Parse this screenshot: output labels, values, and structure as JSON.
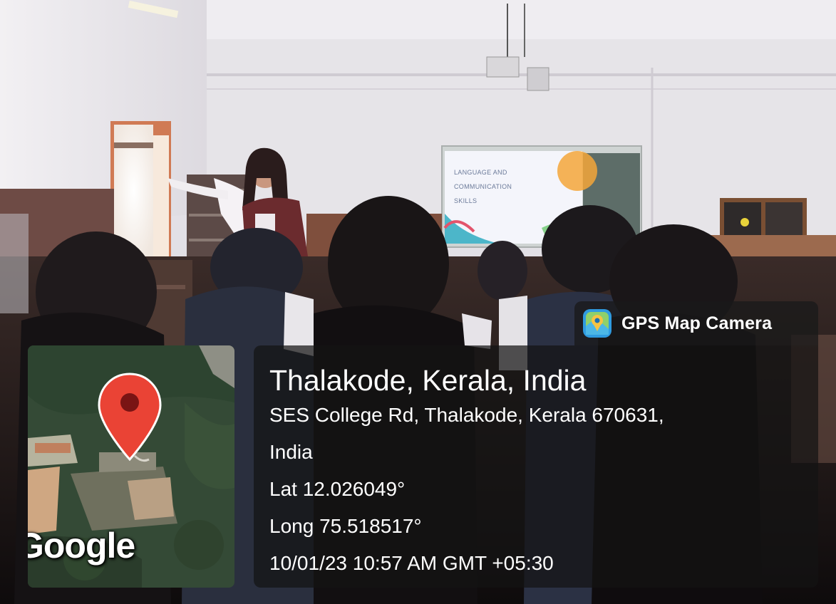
{
  "overlay": {
    "app_name": "GPS Map Camera",
    "app_icon": "gps-map-camera-icon",
    "location_title": "Thalakode, Kerala, India",
    "address_line1": "SES College Rd, Thalakode, Kerala 670631,",
    "address_line2": "India",
    "latitude": "Lat 12.026049°",
    "longitude": "Long 75.518517°",
    "datetime": "10/01/23 10:57 AM GMT +05:30",
    "map_attribution": "Google",
    "map_pin": "map-pin-icon"
  },
  "scene": {
    "slide_line1": "LANGUAGE AND",
    "slide_line2": "COMMUNICATION",
    "slide_line3": "SKILLS",
    "colors": {
      "wall": "#e8e6ea",
      "pin_red": "#e53935",
      "panel_bg": "#141414"
    }
  }
}
